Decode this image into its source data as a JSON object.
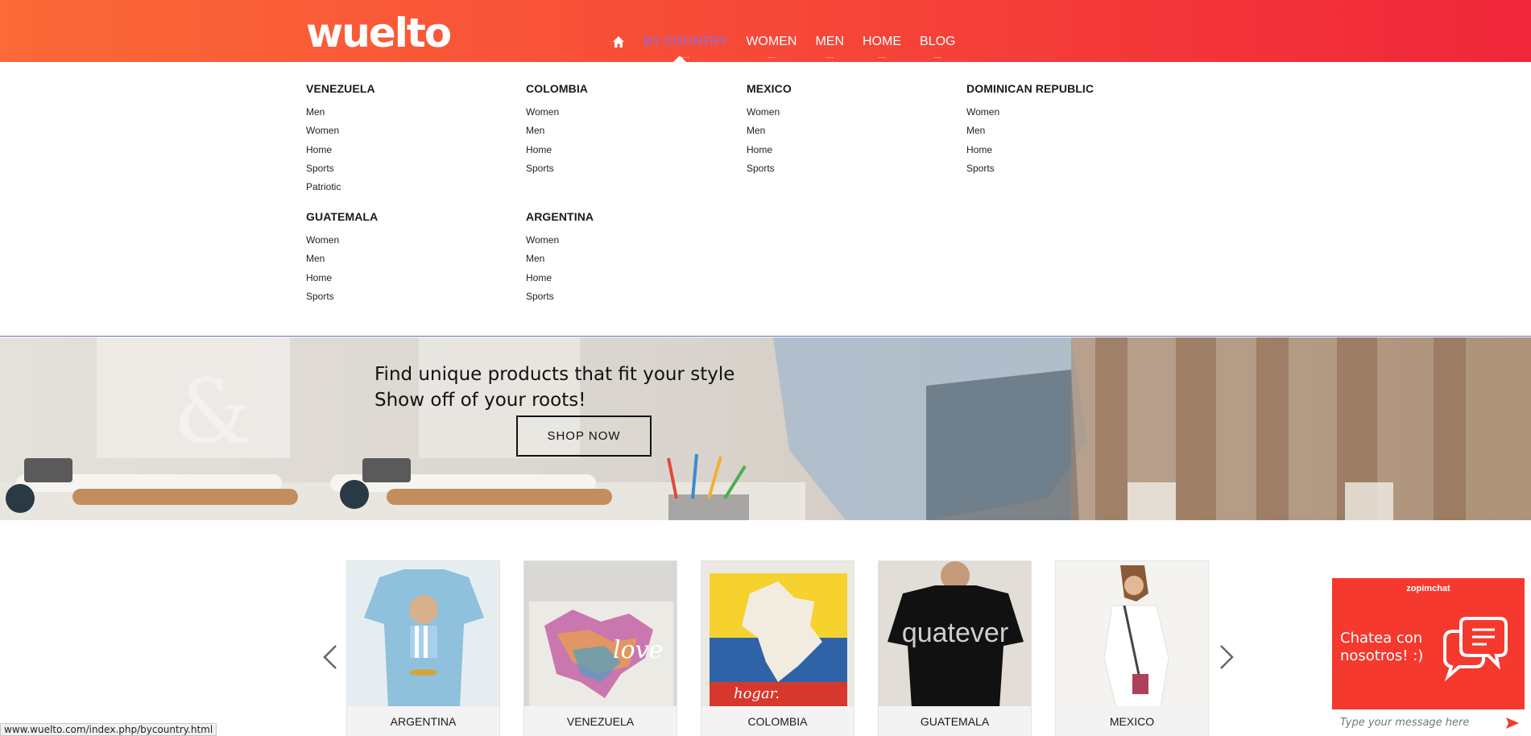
{
  "brand": {
    "logo": "wuelto"
  },
  "nav": {
    "items": [
      {
        "label": "BY COUNTRY",
        "active": true
      },
      {
        "label": "WOMEN",
        "active": false
      },
      {
        "label": "MEN",
        "active": false
      },
      {
        "label": "HOME",
        "active": false
      },
      {
        "label": "BLOG",
        "active": false
      }
    ],
    "dots": "...."
  },
  "mega_menu": {
    "countries": [
      {
        "name": "VENEZUELA",
        "links": [
          "Men",
          "Women",
          "Home",
          "Sports",
          "Patriotic"
        ]
      },
      {
        "name": "COLOMBIA",
        "links": [
          "Women",
          "Men",
          "Home",
          "Sports"
        ]
      },
      {
        "name": "MEXICO",
        "links": [
          "Women",
          "Men",
          "Home",
          "Sports"
        ]
      },
      {
        "name": "DOMINICAN REPUBLIC",
        "links": [
          "Women",
          "Men",
          "Home",
          "Sports"
        ]
      },
      {
        "name": "GUATEMALA",
        "links": [
          "Women",
          "Men",
          "Home",
          "Sports"
        ]
      },
      {
        "name": "ARGENTINA",
        "links": [
          "Women",
          "Men",
          "Home",
          "Sports"
        ]
      }
    ]
  },
  "hero": {
    "line1": "Find unique products that fit your style",
    "line2": "Show off of your roots!",
    "cta": "SHOP NOW"
  },
  "carousel": {
    "cards": [
      {
        "label": "ARGENTINA",
        "bg": "#8fc0dc"
      },
      {
        "label": "VENEZUELA",
        "bg": "#d9d8d4"
      },
      {
        "label": "COLOMBIA",
        "bg": "#ece9e3"
      },
      {
        "label": "GUATEMALA",
        "bg": "#e2ddd7"
      },
      {
        "label": "MEXICO",
        "bg": "#f5f3f0"
      }
    ],
    "card3_text": "hogar.",
    "card4_text": "quatever"
  },
  "status_url": "www.wuelto.com/index.php/bycountry.html",
  "chat": {
    "brand": "zopimchat",
    "line1": "Chatea con",
    "line2": "nosotros! :)",
    "placeholder": "Type your message here"
  },
  "colors": {
    "header_start": "#fb6a38",
    "header_end": "#f0263a",
    "active_nav": "#8a6fe0",
    "chat": "#f5392e"
  }
}
